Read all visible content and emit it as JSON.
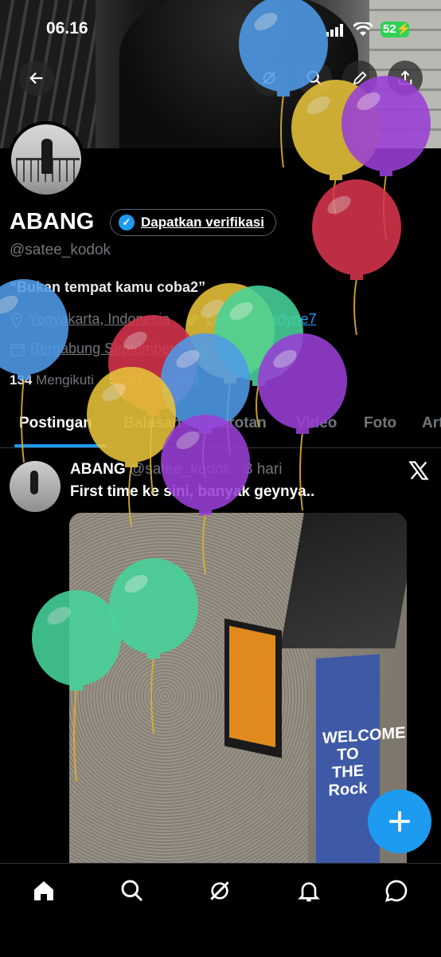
{
  "status_bar": {
    "time": "06.16",
    "battery": "52"
  },
  "profile": {
    "name": "ABANG",
    "verify_button": "Dapatkan verifikasi",
    "handle": "@satee_kodok",
    "bio": "“Bukan tempat kamu coba2”",
    "location": "Yogyakarta, Indonesia",
    "website": "carrd.site/adyne7",
    "joined": "Bergabung September 2023",
    "following_count": "134",
    "following_label": "Mengikuti",
    "followers_count": "5.264",
    "followers_label": "Pengikut"
  },
  "tabs": [
    "Postingan",
    "Balasan",
    "Sorotan",
    "Video",
    "Foto",
    "Artikel"
  ],
  "post": {
    "author": "ABANG",
    "handle": "@satee_kodok",
    "time": "· 3 hari",
    "text": "First time ke sini, banyak geynya..",
    "image_sign": "WELCOME TO THE Rock"
  },
  "colors": {
    "accent": "#1d9bf0",
    "muted": "#71767b",
    "background": "#000000"
  },
  "icons": [
    "back-icon",
    "grok-icon",
    "search-icon",
    "edit-icon",
    "share-icon",
    "location-icon",
    "link-icon",
    "calendar-icon",
    "x-logo-icon",
    "plus-icon",
    "home-icon",
    "search-icon",
    "grok-icon",
    "bell-icon",
    "message-icon"
  ]
}
